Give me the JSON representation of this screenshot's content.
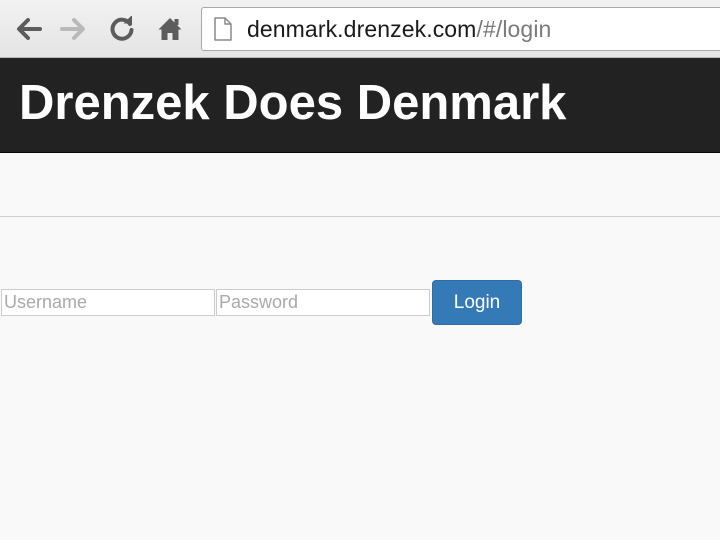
{
  "browser": {
    "url_host": "denmark.drenzek.com",
    "url_path": "/#/login",
    "icons": {
      "back": "back-arrow-icon",
      "forward": "forward-arrow-icon",
      "reload": "reload-icon",
      "home": "home-icon",
      "page": "page-icon"
    }
  },
  "navbar": {
    "brand": "Drenzek Does Denmark"
  },
  "login": {
    "username_placeholder": "Username",
    "password_placeholder": "Password",
    "button_label": "Login"
  },
  "colors": {
    "navbar_bg": "#222222",
    "button_bg": "#337ab7",
    "page_bg": "#f9f9f9"
  }
}
